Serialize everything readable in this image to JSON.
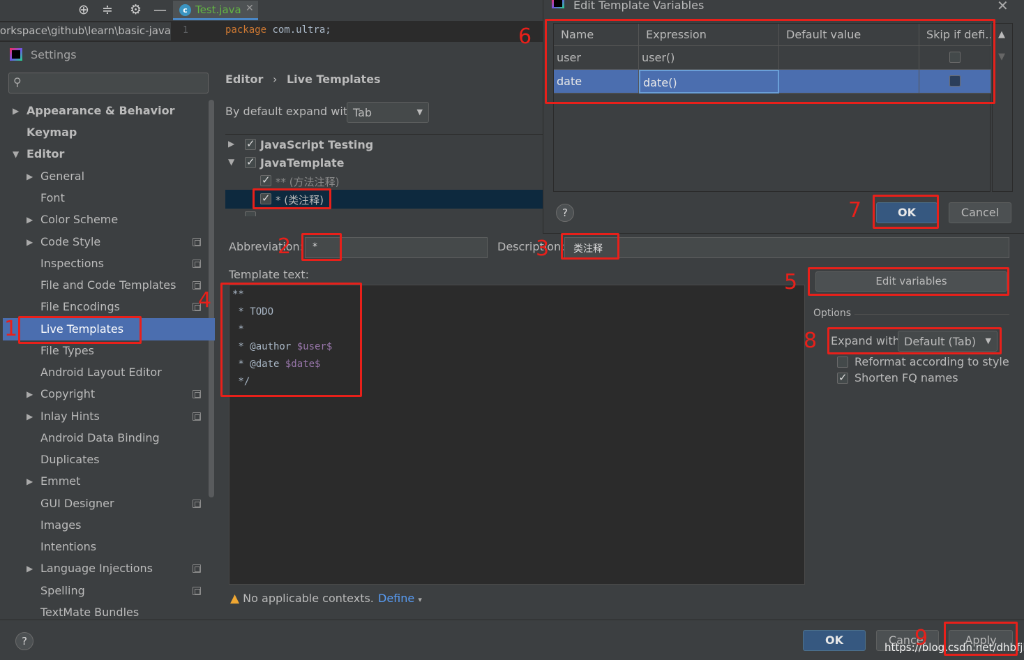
{
  "ide": {
    "tab_file": "Test.java",
    "path": "workspace\\github\\learn\\basic-java",
    "line_number": "1",
    "code_keyword": "package",
    "code_rest": " com.ultra;"
  },
  "settings": {
    "title": "Settings",
    "search_placeholder": "",
    "sidebar": {
      "items": [
        {
          "label": "Appearance & Behavior"
        },
        {
          "label": "Keymap"
        },
        {
          "label": "Editor"
        },
        {
          "label": "General"
        },
        {
          "label": "Font"
        },
        {
          "label": "Color Scheme"
        },
        {
          "label": "Code Style"
        },
        {
          "label": "Inspections"
        },
        {
          "label": "File and Code Templates"
        },
        {
          "label": "File Encodings"
        },
        {
          "label": "Live Templates"
        },
        {
          "label": "File Types"
        },
        {
          "label": "Android Layout Editor"
        },
        {
          "label": "Copyright"
        },
        {
          "label": "Inlay Hints"
        },
        {
          "label": "Android Data Binding"
        },
        {
          "label": "Duplicates"
        },
        {
          "label": "Emmet"
        },
        {
          "label": "GUI Designer"
        },
        {
          "label": "Images"
        },
        {
          "label": "Intentions"
        },
        {
          "label": "Language Injections"
        },
        {
          "label": "Spelling"
        },
        {
          "label": "TextMate Bundles"
        }
      ]
    },
    "breadcrumb": {
      "parent": "Editor",
      "sep": "›",
      "current": "Live Templates"
    },
    "expand_default_label": "By default expand with",
    "expand_default_value": "Tab",
    "template_groups": [
      {
        "label": "JavaScript Testing"
      },
      {
        "label": "JavaTemplate"
      },
      {
        "label": "** (方法注释)"
      },
      {
        "label": "* (类注释)"
      }
    ],
    "abbreviation_label": "Abbreviation:",
    "abbreviation_value": "*",
    "description_label": "Description:",
    "description_value": "类注释",
    "template_text_label": "Template text:",
    "template_lines": [
      "**",
      " * TODO",
      " *",
      " * @author ",
      " * @date ",
      " */"
    ],
    "template_vars": {
      "user": "$user$",
      "date": "$date$"
    },
    "no_context_text": "No applicable contexts.",
    "define_label": "Define",
    "edit_variables_label": "Edit variables",
    "options_label": "Options",
    "expand_with_label": "Expand with",
    "expand_with_value": "Default (Tab)",
    "reformat_label": "Reformat according to style",
    "shorten_label": "Shorten FQ names",
    "ok_label": "OK",
    "cancel_label": "Cancel",
    "apply_label": "Apply",
    "watermark": "https://blog.csdn.net/dhbfjh"
  },
  "dialog": {
    "title": "Edit Template Variables",
    "columns": [
      "Name",
      "Expression",
      "Default value",
      "Skip if defi..."
    ],
    "rows": [
      {
        "name": "user",
        "expression": "user()",
        "default": "",
        "skip": false
      },
      {
        "name": "date",
        "expression": "date()",
        "default": "",
        "skip": false
      }
    ],
    "ok_label": "OK",
    "cancel_label": "Cancel"
  },
  "annotations": [
    "1",
    "2",
    "3",
    "4",
    "5",
    "6",
    "7",
    "8",
    "9"
  ],
  "colors": {
    "highlight": "#e8201a",
    "selection": "#4b6eaf",
    "primary_button": "#365880"
  }
}
